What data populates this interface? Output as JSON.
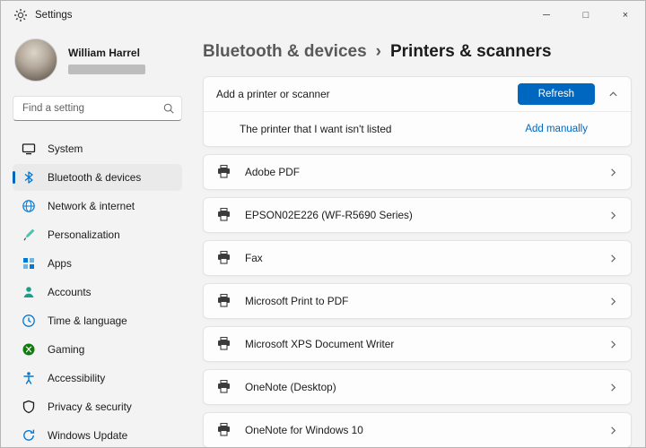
{
  "window": {
    "title": "Settings",
    "controls": [
      {
        "name": "minimize",
        "glyph": "─"
      },
      {
        "name": "maximize",
        "glyph": "□"
      },
      {
        "name": "close",
        "glyph": "×"
      }
    ]
  },
  "sidebar": {
    "user": {
      "name": "William Harrel"
    },
    "search": {
      "placeholder": "Find a setting"
    },
    "items": [
      {
        "label": "System",
        "icon": "system-icon",
        "selected": false
      },
      {
        "label": "Bluetooth & devices",
        "icon": "bluetooth-icon",
        "selected": true
      },
      {
        "label": "Network & internet",
        "icon": "network-icon",
        "selected": false
      },
      {
        "label": "Personalization",
        "icon": "personalization-icon",
        "selected": false
      },
      {
        "label": "Apps",
        "icon": "apps-icon",
        "selected": false
      },
      {
        "label": "Accounts",
        "icon": "accounts-icon",
        "selected": false
      },
      {
        "label": "Time & language",
        "icon": "time-language-icon",
        "selected": false
      },
      {
        "label": "Gaming",
        "icon": "gaming-icon",
        "selected": false
      },
      {
        "label": "Accessibility",
        "icon": "accessibility-icon",
        "selected": false
      },
      {
        "label": "Privacy & security",
        "icon": "privacy-icon",
        "selected": false
      },
      {
        "label": "Windows Update",
        "icon": "windows-update-icon",
        "selected": false
      }
    ]
  },
  "header": {
    "breadcrumb": [
      "Bluetooth & devices",
      "Printers & scanners"
    ],
    "separator": "›"
  },
  "main": {
    "add_card": {
      "label": "Add a printer or scanner",
      "refresh_label": "Refresh",
      "not_listed_label": "The printer that I want isn't listed",
      "add_manually_label": "Add manually"
    },
    "printers": [
      "Adobe PDF",
      "EPSON02E226 (WF-R5690 Series)",
      "Fax",
      "Microsoft Print to PDF",
      "Microsoft XPS Document Writer",
      "OneNote (Desktop)",
      "OneNote for Windows 10"
    ]
  },
  "icons": {
    "settings-gear-icon": "gear",
    "search-icon": "magnifier",
    "printer-icon": "printer",
    "chevron-up-icon": "chevron-up",
    "chevron-right-icon": "chevron-right"
  },
  "colors": {
    "accent": "#0067c0",
    "background": "#f3f3f3",
    "card": "#fdfdfd",
    "selected_nav": "#eaeaea"
  }
}
